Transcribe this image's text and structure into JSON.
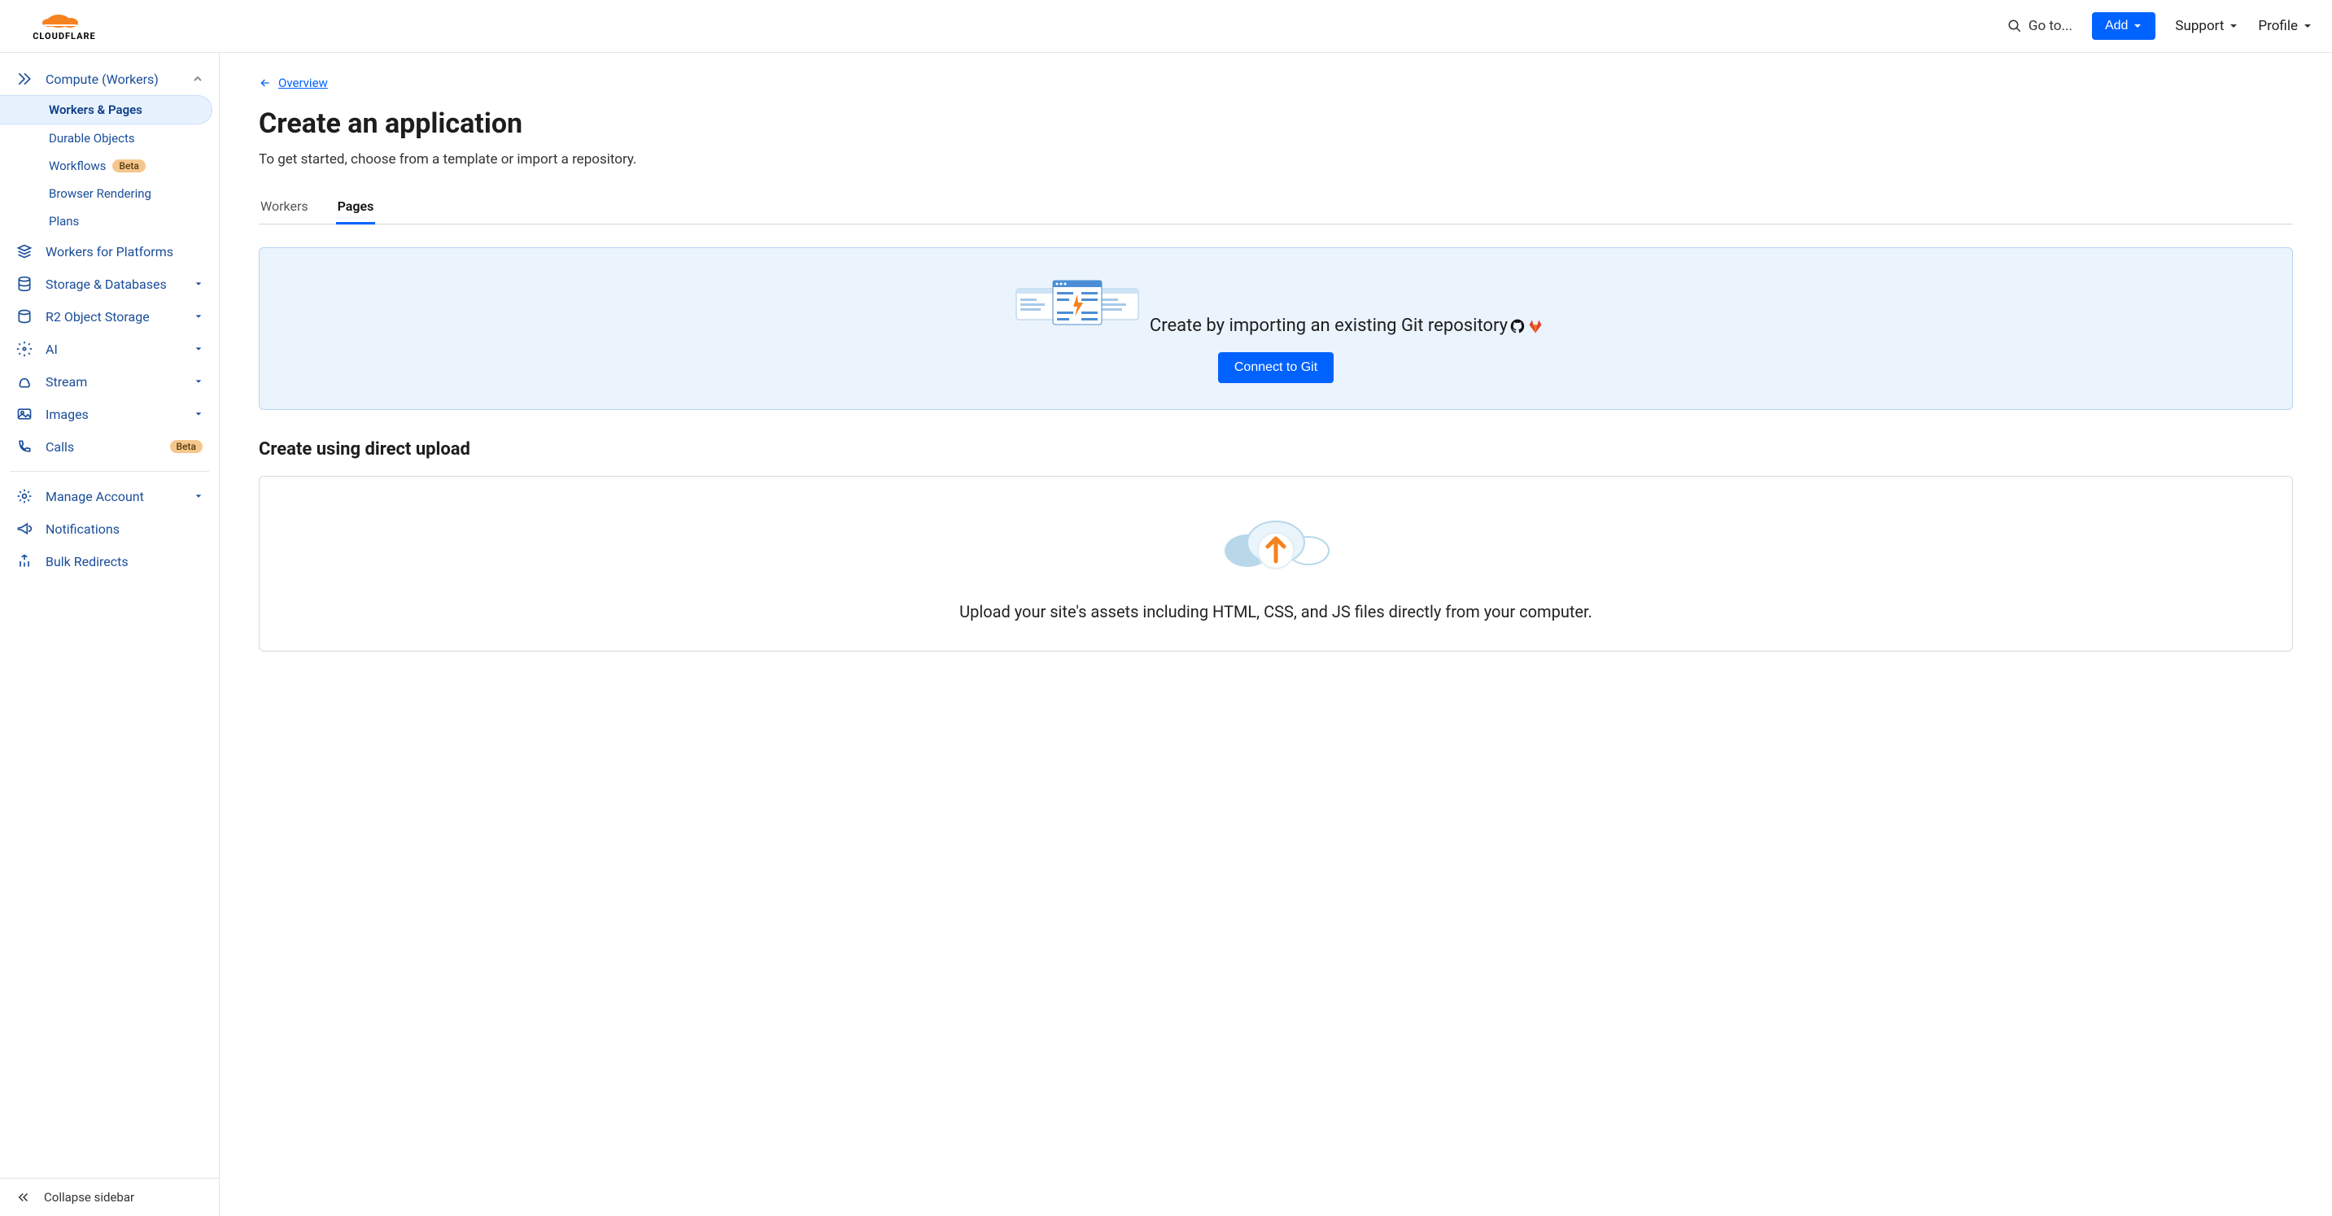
{
  "header": {
    "goto": "Go to...",
    "add": "Add",
    "support": "Support",
    "profile": "Profile"
  },
  "sidebar": {
    "compute": "Compute (Workers)",
    "sub": {
      "workers_pages": "Workers & Pages",
      "durable": "Durable Objects",
      "workflows": "Workflows",
      "workflows_badge": "Beta",
      "browser": "Browser Rendering",
      "plans": "Plans"
    },
    "platforms": "Workers for Platforms",
    "storage": "Storage & Databases",
    "r2": "R2 Object Storage",
    "ai": "AI",
    "stream": "Stream",
    "images": "Images",
    "calls": "Calls",
    "calls_badge": "Beta",
    "manage": "Manage Account",
    "notifications": "Notifications",
    "bulk": "Bulk Redirects",
    "collapse": "Collapse sidebar"
  },
  "main": {
    "back": "Overview",
    "title": "Create an application",
    "subtitle": "To get started, choose from a template or import a repository.",
    "tabs": {
      "workers": "Workers",
      "pages": "Pages"
    },
    "git_card": {
      "heading": "Create by importing an existing Git repository",
      "button": "Connect to Git"
    },
    "upload": {
      "title": "Create using direct upload",
      "text": "Upload your site's assets including HTML, CSS, and JS files directly from your computer."
    }
  }
}
